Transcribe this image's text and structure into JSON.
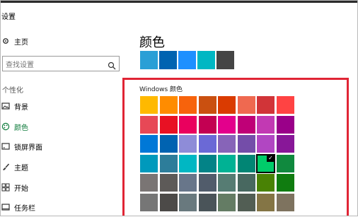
{
  "window": {
    "title": "设置"
  },
  "sidebar": {
    "home": {
      "label": "主页"
    },
    "search": {
      "placeholder": "查找设置",
      "value": ""
    },
    "section_label": "个性化",
    "items": [
      {
        "label": "背景",
        "icon": "image-icon"
      },
      {
        "label": "颜色",
        "icon": "palette-icon",
        "active": true
      },
      {
        "label": "锁屏界面",
        "icon": "lockscreen-icon"
      },
      {
        "label": "主题",
        "icon": "brush-icon"
      },
      {
        "label": "开始",
        "icon": "start-icon"
      },
      {
        "label": "任务栏",
        "icon": "taskbar-icon"
      }
    ]
  },
  "main": {
    "heading": "颜色",
    "recent_colors": [
      "#2a9fd6",
      "#0063b1",
      "#1e90ff",
      "#00b7c3",
      "#454545"
    ],
    "windows_colors_title": "Windows 颜色",
    "windows_colors": [
      [
        "#ffb900",
        "#ff8c00",
        "#f7630c",
        "#ca5010",
        "#da3b01",
        "#ef6950",
        "#d13438",
        "#ff4343"
      ],
      [
        "#e74856",
        "#e81123",
        "#ea005e",
        "#c30052",
        "#e3008c",
        "#bf0077",
        "#c239b3",
        "#9a0089"
      ],
      [
        "#0078d7",
        "#0063b1",
        "#8e8cd8",
        "#6b69d6",
        "#8764b8",
        "#744da9",
        "#b146c2",
        "#881798"
      ],
      [
        "#0099bc",
        "#2d7d9a",
        "#00b7c3",
        "#038387",
        "#00b294",
        "#018574",
        "#00cc6a",
        "#10893e"
      ],
      [
        "#7a7574",
        "#5d5a58",
        "#68768a",
        "#515c6b",
        "#567c73",
        "#486860",
        "#498205",
        "#107c10"
      ],
      [
        "#767676",
        "#4c4a48",
        "#69797e",
        "#4a5459",
        "#647c64",
        "#525e54",
        "#847545",
        "#7e735f"
      ]
    ],
    "selected_color": "#00cc6a"
  }
}
